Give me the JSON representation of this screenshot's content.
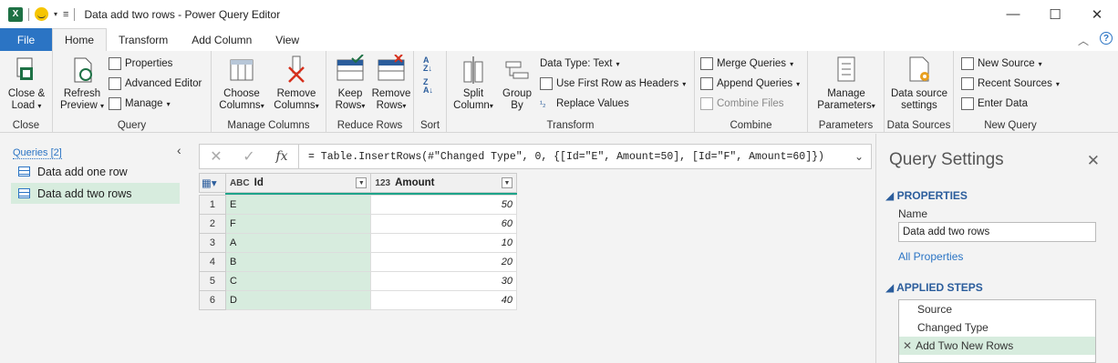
{
  "window": {
    "title": "Data add two rows - Power Query Editor",
    "app_icon": "X",
    "controls": {
      "minimize": "—",
      "maximize": "☐",
      "close": "✕"
    }
  },
  "tabs": [
    {
      "label": "File"
    },
    {
      "label": "Home"
    },
    {
      "label": "Transform"
    },
    {
      "label": "Add Column"
    },
    {
      "label": "View"
    }
  ],
  "ribbon": {
    "close_group": {
      "label": "Close",
      "close_load_1": "Close &",
      "close_load_2": "Load"
    },
    "query_group": {
      "label": "Query",
      "refresh_1": "Refresh",
      "refresh_2": "Preview",
      "properties": "Properties",
      "advanced_editor": "Advanced Editor",
      "manage": "Manage"
    },
    "manage_columns_group": {
      "label": "Manage Columns",
      "choose_1": "Choose",
      "choose_2": "Columns",
      "remove_1": "Remove",
      "remove_2": "Columns"
    },
    "reduce_rows_group": {
      "label": "Reduce Rows",
      "keep_1": "Keep",
      "keep_2": "Rows",
      "remove_1": "Remove",
      "remove_2": "Rows"
    },
    "sort_group": {
      "label": "Sort"
    },
    "transform_group": {
      "label": "Transform",
      "split_1": "Split",
      "split_2": "Column",
      "group_1": "Group",
      "group_2": "By",
      "data_type": "Data Type: Text",
      "first_row": "Use First Row as Headers",
      "replace": "Replace Values"
    },
    "combine_group": {
      "label": "Combine",
      "merge": "Merge Queries",
      "append": "Append Queries",
      "combine_files": "Combine Files"
    },
    "parameters_group": {
      "label": "Parameters",
      "manage_1": "Manage",
      "manage_2": "Parameters"
    },
    "data_sources_group": {
      "label": "Data Sources",
      "settings_1": "Data source",
      "settings_2": "settings"
    },
    "new_query_group": {
      "label": "New Query",
      "new_source": "New Source",
      "recent_sources": "Recent Sources",
      "enter_data": "Enter Data"
    }
  },
  "queries_pane": {
    "header": "Queries [2]",
    "items": [
      {
        "label": "Data add one row"
      },
      {
        "label": "Data add two rows"
      }
    ]
  },
  "formula_bar": {
    "formula": "= Table.InsertRows(#\"Changed Type\", 0, {[Id=\"E\", Amount=50], [Id=\"F\", Amount=60]})"
  },
  "table": {
    "columns": [
      {
        "type": "ABC",
        "name": "Id"
      },
      {
        "type": "123",
        "name": "Amount"
      }
    ],
    "rows": [
      {
        "n": "1",
        "id": "E",
        "amount": "50"
      },
      {
        "n": "2",
        "id": "F",
        "amount": "60"
      },
      {
        "n": "3",
        "id": "A",
        "amount": "10"
      },
      {
        "n": "4",
        "id": "B",
        "amount": "20"
      },
      {
        "n": "5",
        "id": "C",
        "amount": "30"
      },
      {
        "n": "6",
        "id": "D",
        "amount": "40"
      }
    ]
  },
  "settings": {
    "title": "Query Settings",
    "properties_header": "PROPERTIES",
    "name_label": "Name",
    "name_value": "Data add two rows",
    "all_properties": "All Properties",
    "steps_header": "APPLIED STEPS",
    "steps": [
      {
        "label": "Source"
      },
      {
        "label": "Changed Type"
      },
      {
        "label": "Add Two New Rows"
      }
    ]
  },
  "colors": {
    "accent": "#2b74c4",
    "selected": "#d7ecde",
    "excel_green": "#1e7145"
  }
}
